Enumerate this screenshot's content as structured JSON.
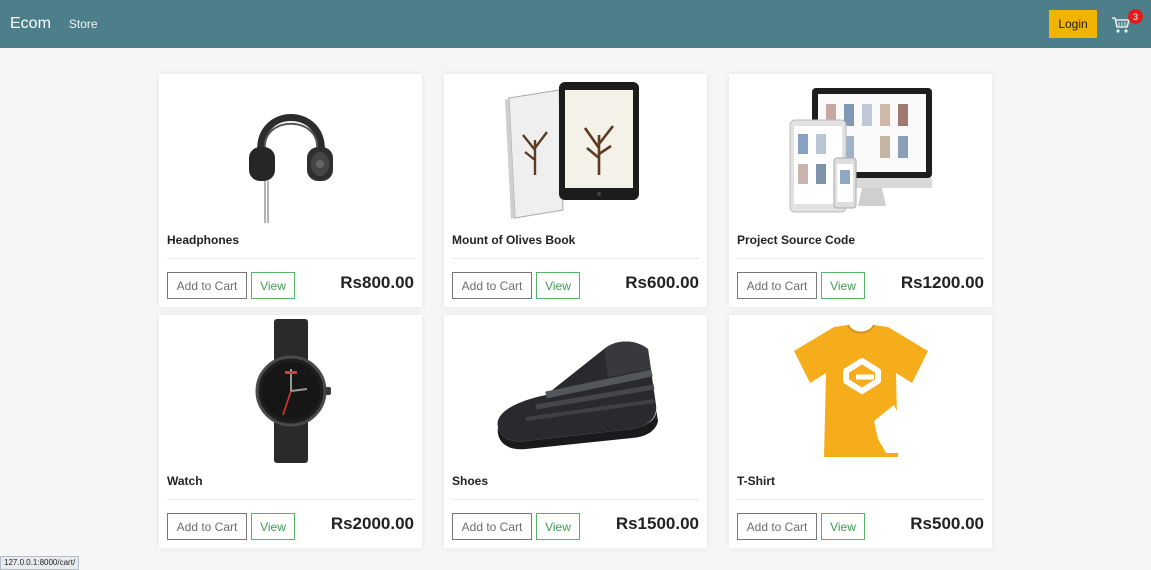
{
  "navbar": {
    "brand": "Ecom",
    "store_link": "Store",
    "login_label": "Login",
    "cart_count": "3",
    "bg_color": "#4d7f8b",
    "login_color": "#f0b300",
    "badge_color": "#e31b1b"
  },
  "products": [
    {
      "name": "Headphones",
      "price": "Rs800.00",
      "add_label": "Add to Cart",
      "view_label": "View",
      "image_icon": "headphones-icon"
    },
    {
      "name": "Mount of Olives Book",
      "price": "Rs600.00",
      "add_label": "Add to Cart",
      "view_label": "View",
      "image_icon": "book-tablet-icon"
    },
    {
      "name": "Project Source Code",
      "price": "Rs1200.00",
      "add_label": "Add to Cart",
      "view_label": "View",
      "image_icon": "devices-icon"
    },
    {
      "name": "Watch",
      "price": "Rs2000.00",
      "add_label": "Add to Cart",
      "view_label": "View",
      "image_icon": "watch-icon"
    },
    {
      "name": "Shoes",
      "price": "Rs1500.00",
      "add_label": "Add to Cart",
      "view_label": "View",
      "image_icon": "shoe-icon"
    },
    {
      "name": "T-Shirt",
      "price": "Rs500.00",
      "add_label": "Add to Cart",
      "view_label": "View",
      "image_icon": "tshirt-icon"
    }
  ],
  "status_bar": {
    "url": "127.0.0.1:8000/cart/"
  }
}
